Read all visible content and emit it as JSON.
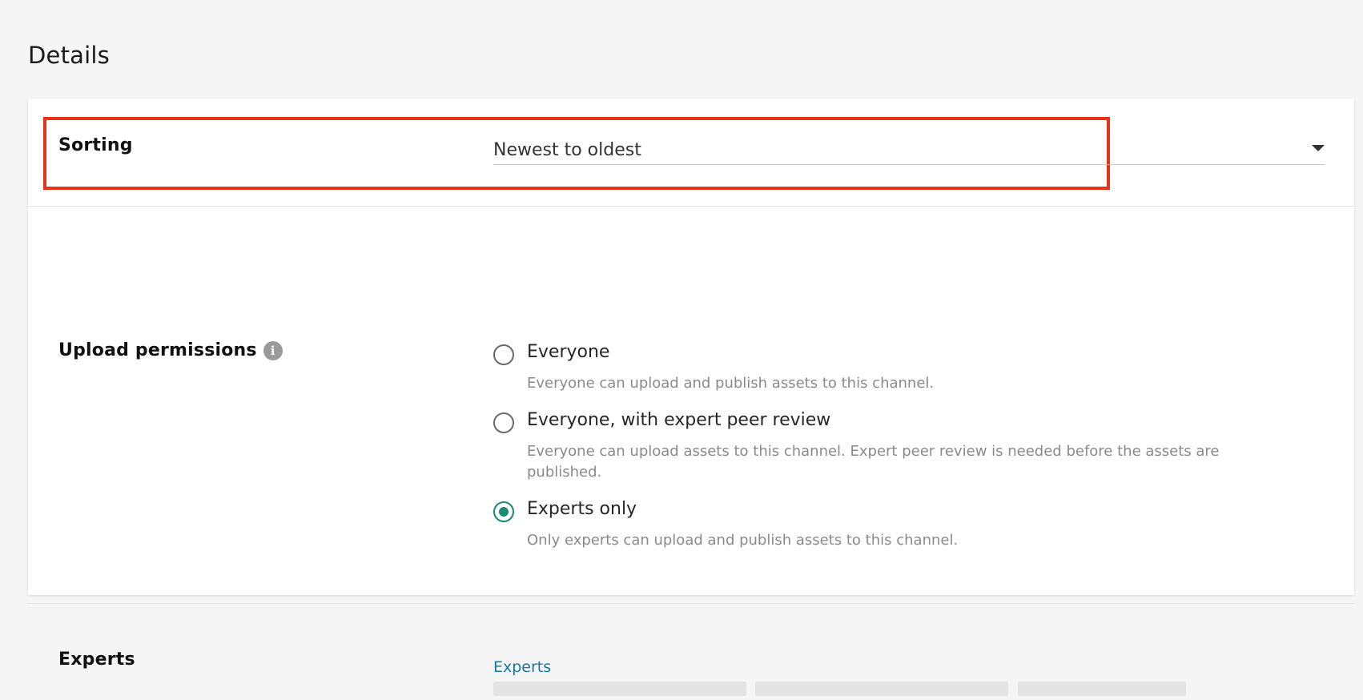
{
  "page": {
    "title": "Details"
  },
  "sorting": {
    "label": "Sorting",
    "value": "Newest to oldest"
  },
  "upload_permissions": {
    "label": "Upload permissions",
    "info_icon": "info-icon",
    "options": [
      {
        "label": "Everyone",
        "description": "Everyone can upload and publish assets to this channel.",
        "selected": false
      },
      {
        "label": "Everyone, with expert peer review",
        "description": "Everyone can upload assets to this channel. Expert peer review is needed before the assets are published.",
        "selected": false
      },
      {
        "label": "Experts only",
        "description": "Only experts can upload and publish assets to this channel.",
        "selected": true
      }
    ]
  },
  "experts": {
    "label": "Experts",
    "link_label": "Experts"
  },
  "colors": {
    "highlight": "#e8321a",
    "selected_radio": "#1a8a72",
    "link": "#1577a6"
  }
}
